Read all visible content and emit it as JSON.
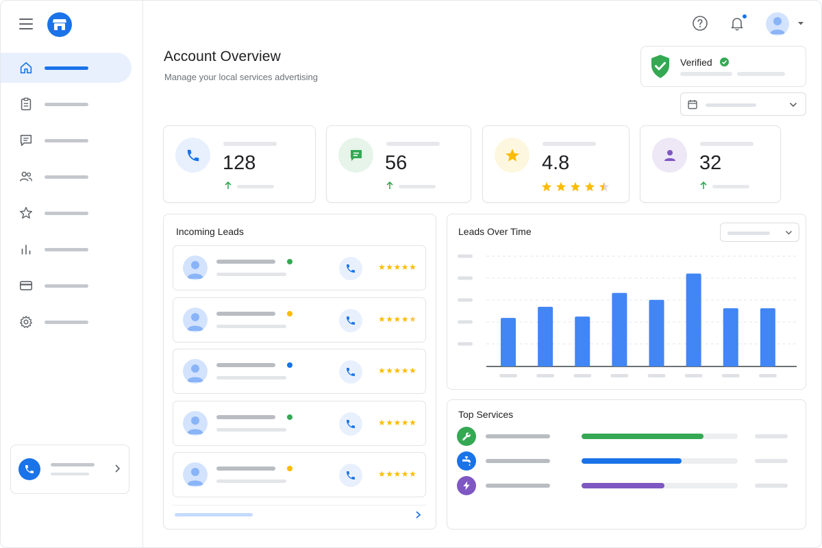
{
  "header": {
    "title": "Account Overview",
    "subtitle": "Manage your local services advertising",
    "verified_label": "Verified",
    "icons": [
      "menu-icon",
      "storefront-logo",
      "help-icon",
      "bell-icon",
      "avatar"
    ]
  },
  "sidebar": {
    "items": [
      {
        "icon": "home-icon",
        "active": true
      },
      {
        "icon": "clipboard-icon",
        "active": false
      },
      {
        "icon": "message-icon",
        "active": false
      },
      {
        "icon": "people-icon",
        "active": false
      },
      {
        "icon": "star-icon",
        "active": false
      },
      {
        "icon": "bar-chart-icon",
        "active": false
      },
      {
        "icon": "credit-card-icon",
        "active": false
      },
      {
        "icon": "gear-icon",
        "active": false
      }
    ]
  },
  "stats": [
    {
      "icon": "phone-icon",
      "value": "128",
      "trend": "up",
      "color": "#1a73e8"
    },
    {
      "icon": "message-icon",
      "value": "56",
      "trend": "up",
      "color": "#34a853"
    },
    {
      "icon": "star-icon",
      "value": "4.8",
      "rating": 4.5,
      "color": "#fbbc04"
    },
    {
      "icon": "person-icon",
      "value": "32",
      "trend": "up",
      "color": "#7e57c2"
    }
  ],
  "leads": {
    "title": "Incoming Leads",
    "items": [
      {
        "status_color": "#34a853",
        "rating": 5
      },
      {
        "status_color": "#fbbc04",
        "rating": 4.5
      },
      {
        "status_color": "#1a73e8",
        "rating": 5
      },
      {
        "status_color": "#34a853",
        "rating": 5
      },
      {
        "status_color": "#fbbc04",
        "rating": 5
      }
    ]
  },
  "chart_data": {
    "type": "bar",
    "title": "Leads Over Time",
    "values": [
      35,
      43,
      36,
      53,
      48,
      67,
      42,
      42
    ],
    "ylim": [
      0,
      80
    ],
    "grid": true,
    "color": "#4285f4"
  },
  "top_services": {
    "title": "Top Services",
    "items": [
      {
        "icon": "wrench-icon",
        "color": "#34a853",
        "progress": 0.78
      },
      {
        "icon": "faucet-icon",
        "color": "#1a73e8",
        "progress": 0.64
      },
      {
        "icon": "bolt-icon",
        "color": "#7e57c2",
        "progress": 0.53
      }
    ]
  },
  "colors": {
    "accent": "#1a73e8",
    "success": "#34a853",
    "warning": "#fbbc04",
    "purple": "#7e57c2"
  }
}
